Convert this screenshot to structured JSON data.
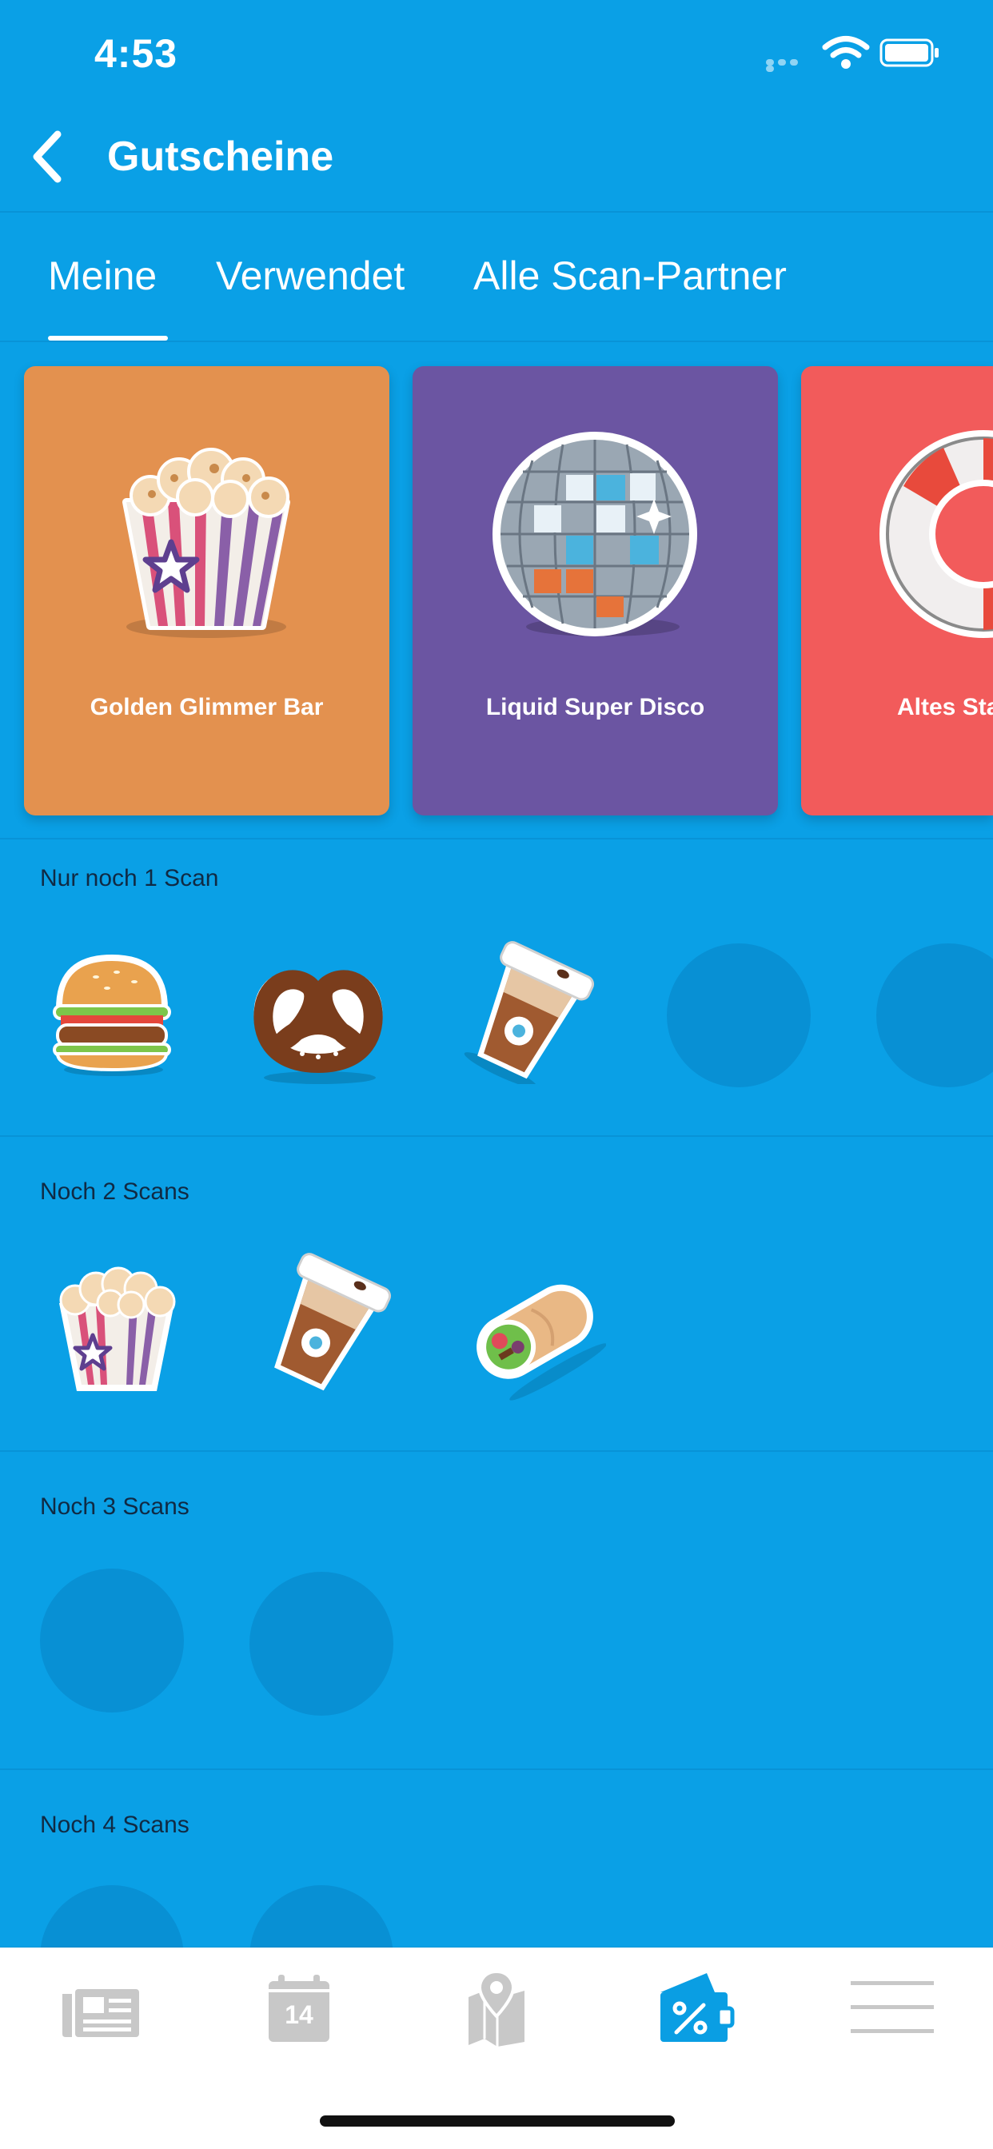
{
  "status_bar": {
    "time": "4:53"
  },
  "header": {
    "title": "Gutscheine"
  },
  "tabs": [
    {
      "label": "Meine",
      "active": true
    },
    {
      "label": "Verwendet",
      "active": false
    },
    {
      "label": "Alle Scan-Partner",
      "active": false
    }
  ],
  "cards": [
    {
      "label": "Golden Glimmer Bar",
      "color": "#e3914f",
      "icon": "popcorn-icon"
    },
    {
      "label": "Liquid Super Disco",
      "color": "#6b55a2",
      "icon": "disco-ball-icon"
    },
    {
      "label": "Altes Sta",
      "color": "#f25b5b",
      "icon": "lifebuoy-icon"
    }
  ],
  "sections": [
    {
      "title": "Nur noch 1 Scan",
      "items": [
        "burger-icon",
        "pretzel-icon",
        "coffee-cup-icon",
        "placeholder",
        "placeholder"
      ]
    },
    {
      "title": "Noch 2 Scans",
      "items": [
        "popcorn-icon",
        "coffee-cup-icon",
        "wrap-icon"
      ]
    },
    {
      "title": "Noch 3 Scans",
      "items": [
        "placeholder",
        "placeholder"
      ]
    },
    {
      "title": "Noch 4 Scans",
      "items": [
        "placeholder",
        "placeholder"
      ]
    }
  ],
  "tab_bar": [
    {
      "icon": "news-icon",
      "active": false
    },
    {
      "icon": "calendar-icon",
      "label": "14",
      "active": false
    },
    {
      "icon": "map-icon",
      "active": false
    },
    {
      "icon": "voucher-icon",
      "active": true
    },
    {
      "icon": "menu-icon",
      "active": false
    }
  ],
  "colors": {
    "background": "#0aa0e6",
    "active_tab_icon": "#0a9ee3",
    "inactive_tab_icon": "#c8c8c8"
  }
}
